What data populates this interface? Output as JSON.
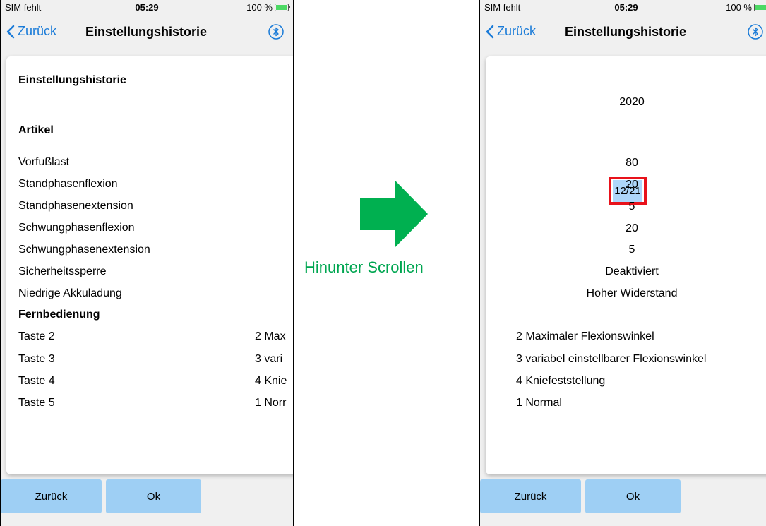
{
  "left": {
    "status": {
      "carrier": "SIM fehlt",
      "time": "05:29",
      "battery": "100 %"
    },
    "nav": {
      "back": "Zurück",
      "title": "Einstellungshistorie"
    },
    "heading": "Einstellungshistorie",
    "section_artikel": "Artikel",
    "items": [
      "Vorfußlast",
      "Standphasenflexion",
      "Standphasenextension",
      "Schwungphasenflexion",
      "Schwungphasenextension",
      "Sicherheitssperre",
      "Niedrige Akkuladung"
    ],
    "section_fernbedienung": "Fernbedienung",
    "taste": [
      {
        "label": "Taste 2",
        "value": "2 Max"
      },
      {
        "label": "Taste 3",
        "value": "3 vari"
      },
      {
        "label": "Taste 4",
        "value": "4 Knie"
      },
      {
        "label": "Taste 5",
        "value": "1 Norr"
      }
    ],
    "buttons": {
      "back": "Zurück",
      "ok": "Ok"
    }
  },
  "right": {
    "status": {
      "carrier": "SIM fehlt",
      "time": "05:29",
      "battery": "100 %"
    },
    "nav": {
      "back": "Zurück",
      "title": "Einstellungshistorie"
    },
    "year": "2020",
    "date": "12/21",
    "values": [
      "80",
      "20",
      "5",
      "20",
      "5",
      "Deaktiviert",
      "Hoher Widerstand"
    ],
    "taste_values": [
      "2 Maximaler Flexionswinkel",
      "3 variabel einstellbarer Flexionswinkel",
      "4 Kniefeststellung",
      "1 Normal"
    ],
    "buttons": {
      "back": "Zurück",
      "ok": "Ok"
    }
  },
  "annotation": {
    "label": "Hinunter Scrollen",
    "arrow_color": "#00b050",
    "highlight_color": "#e8121b"
  }
}
